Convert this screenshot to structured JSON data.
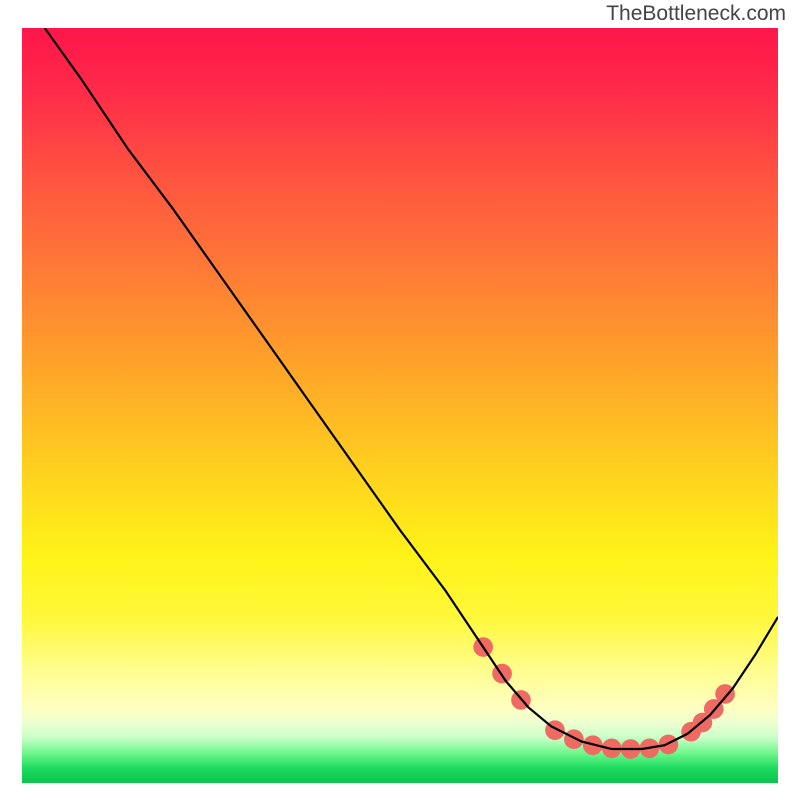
{
  "attribution": "TheBottleneck.com",
  "chart_data": {
    "type": "line",
    "title": "",
    "xlabel": "",
    "ylabel": "",
    "xlim": [
      0,
      100
    ],
    "ylim": [
      0,
      100
    ],
    "grid": false,
    "legend": false,
    "series": [
      {
        "name": "curve",
        "color": "#000000",
        "x": [
          3,
          8,
          14,
          20,
          26,
          32,
          38,
          44,
          50,
          56,
          61,
          64,
          67,
          70,
          74,
          78,
          82,
          85,
          88,
          91,
          94,
          97,
          100
        ],
        "y": [
          100,
          93,
          84,
          76,
          67.5,
          59,
          50.5,
          42,
          33.5,
          25.5,
          18,
          13.5,
          10,
          7.5,
          5.5,
          4.5,
          4.5,
          5,
          6.5,
          9,
          12.5,
          17,
          22
        ]
      }
    ],
    "markers": {
      "name": "highlighted-points",
      "color": "#ee6a63",
      "radius_plot_units": 1.3,
      "x": [
        61,
        63.5,
        66,
        70.5,
        73,
        75.5,
        78,
        80.5,
        83,
        85.5,
        88.5,
        90,
        91.5,
        93
      ],
      "y": [
        18,
        14.5,
        11,
        7,
        5.8,
        5,
        4.6,
        4.5,
        4.6,
        5.1,
        6.8,
        8,
        9.8,
        11.8
      ]
    },
    "background_gradient": {
      "direction": "top-to-bottom",
      "stops": [
        {
          "pos": 0.0,
          "color": "#ff164b"
        },
        {
          "pos": 0.2,
          "color": "#ff5440"
        },
        {
          "pos": 0.45,
          "color": "#ffa429"
        },
        {
          "pos": 0.7,
          "color": "#fff318"
        },
        {
          "pos": 0.9,
          "color": "#feffc0"
        },
        {
          "pos": 0.96,
          "color": "#70f78d"
        },
        {
          "pos": 1.0,
          "color": "#0cc44e"
        }
      ]
    }
  }
}
